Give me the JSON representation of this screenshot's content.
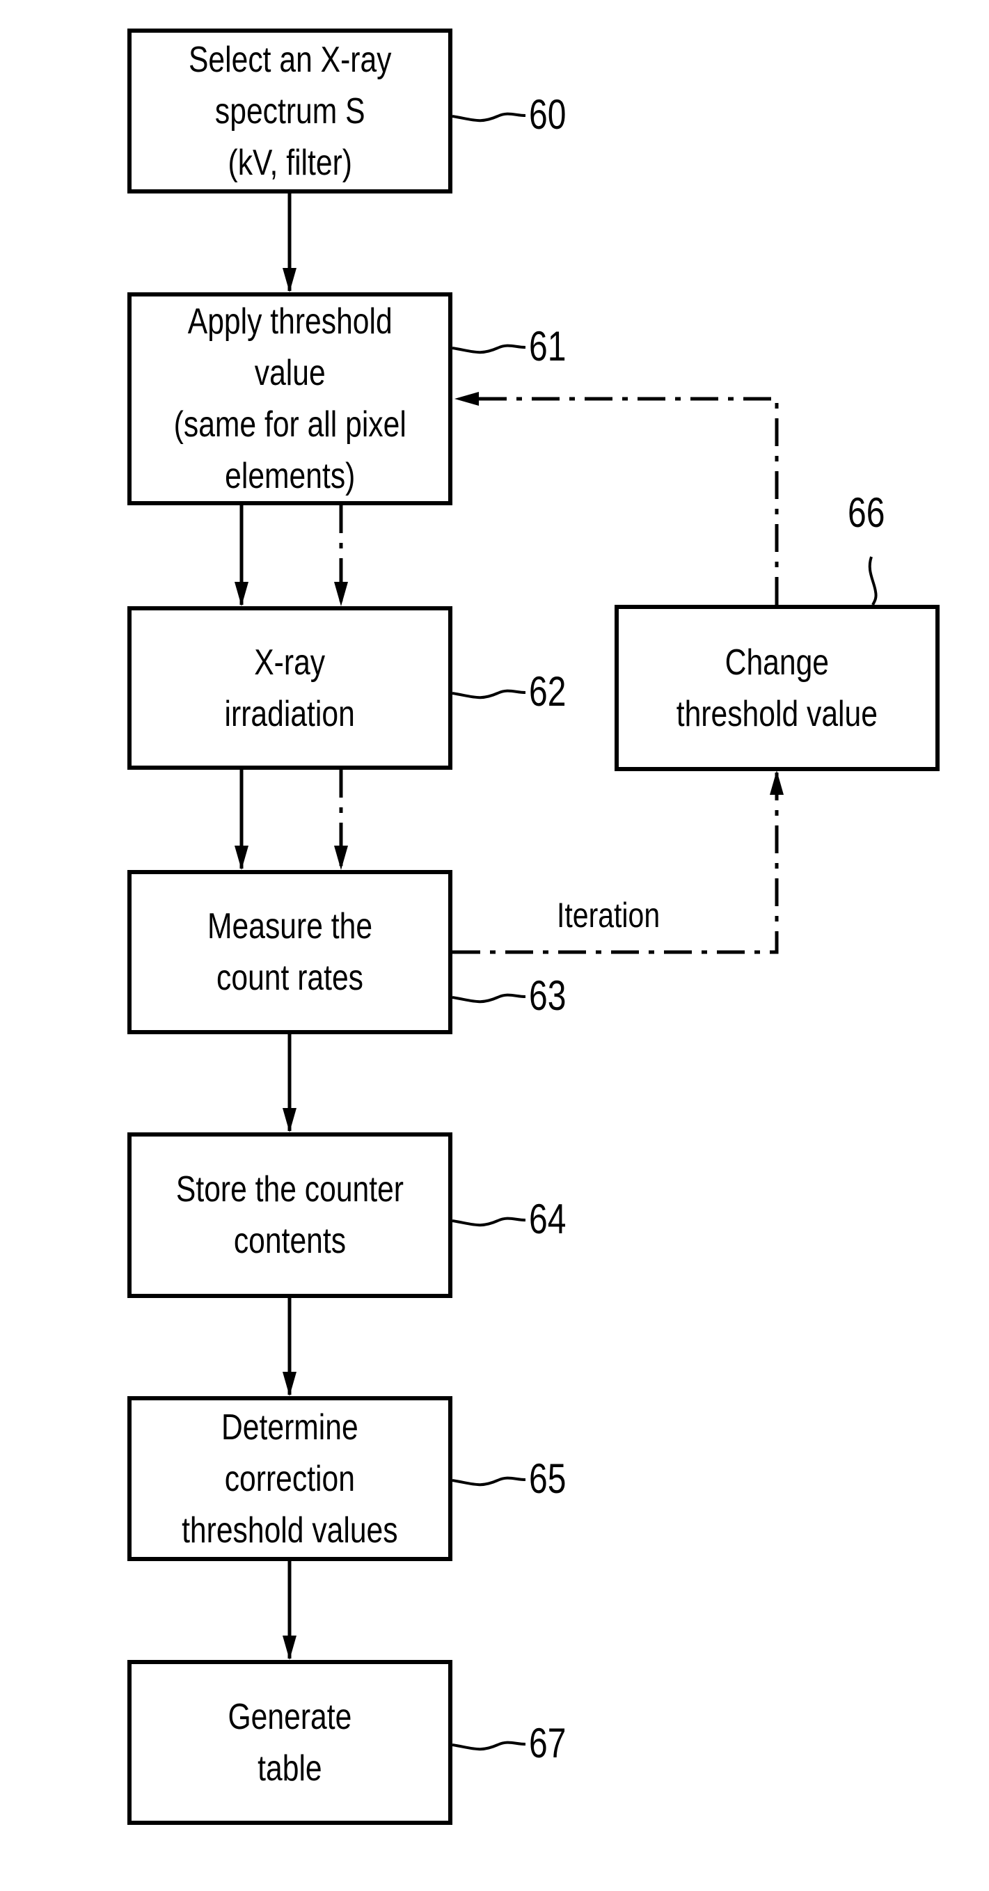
{
  "diagram": {
    "type": "flowchart",
    "steps": [
      {
        "id": "60",
        "label": "Select an X-ray\nspectrum S\n(kV, filter)"
      },
      {
        "id": "61",
        "label": "Apply threshold\nvalue\n(same for all pixel\nelements)"
      },
      {
        "id": "62",
        "label": "X-ray\nirradiation"
      },
      {
        "id": "63",
        "label": "Measure the\ncount rates"
      },
      {
        "id": "64",
        "label": "Store the counter\ncontents"
      },
      {
        "id": "65",
        "label": "Determine\ncorrection\nthreshold values"
      },
      {
        "id": "67",
        "label": "Generate\ntable"
      },
      {
        "id": "66",
        "label": "Change\nthreshold value"
      }
    ],
    "loop_label": "Iteration",
    "edges": [
      {
        "from": "60",
        "to": "61",
        "style": "solid"
      },
      {
        "from": "61",
        "to": "62",
        "style": "solid"
      },
      {
        "from": "61",
        "to": "62",
        "style": "dash-dot"
      },
      {
        "from": "62",
        "to": "63",
        "style": "solid"
      },
      {
        "from": "62",
        "to": "63",
        "style": "dash-dot"
      },
      {
        "from": "63",
        "to": "66",
        "style": "dash-dot",
        "label": "Iteration"
      },
      {
        "from": "66",
        "to": "61",
        "style": "dash-dot"
      },
      {
        "from": "63",
        "to": "64",
        "style": "solid"
      },
      {
        "from": "64",
        "to": "65",
        "style": "solid"
      },
      {
        "from": "65",
        "to": "67",
        "style": "solid"
      }
    ]
  }
}
